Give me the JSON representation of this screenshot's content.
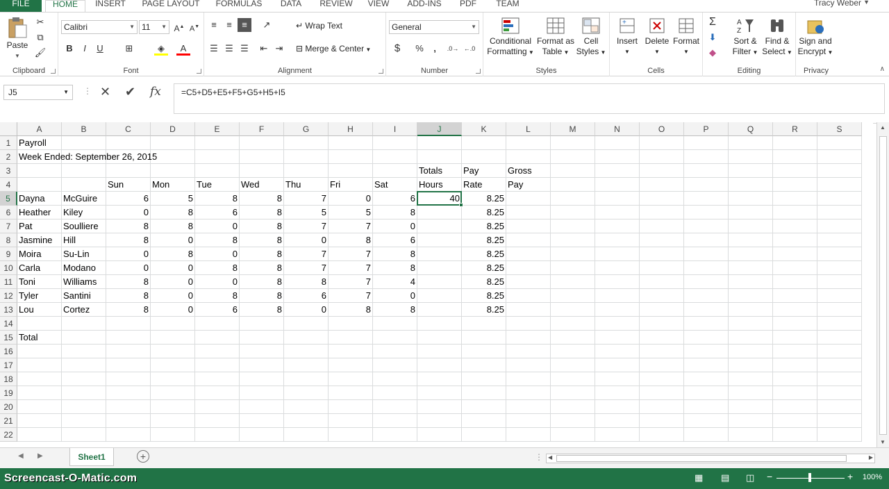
{
  "ribbon_tabs": [
    "FILE",
    "HOME",
    "INSERT",
    "PAGE LAYOUT",
    "FORMULAS",
    "DATA",
    "REVIEW",
    "VIEW",
    "ADD-INS",
    "PDF",
    "TEAM"
  ],
  "active_tab": "HOME",
  "user": "Tracy Weber",
  "clipboard": {
    "label": "Clipboard",
    "paste": "Paste"
  },
  "font": {
    "label": "Font",
    "name": "Calibri",
    "size": "11",
    "bold": "B",
    "italic": "I",
    "underline": "U"
  },
  "alignment": {
    "label": "Alignment",
    "wrap": "Wrap Text",
    "merge": "Merge & Center"
  },
  "number": {
    "label": "Number",
    "format": "General",
    "currency": "$",
    "percent": "%",
    "comma": ","
  },
  "styles": {
    "label": "Styles",
    "cond1": "Conditional",
    "cond2": "Formatting",
    "fmt1": "Format as",
    "fmt2": "Table",
    "cell1": "Cell",
    "cell2": "Styles"
  },
  "cells": {
    "label": "Cells",
    "insert": "Insert",
    "delete": "Delete",
    "format": "Format"
  },
  "editing": {
    "label": "Editing",
    "sort1": "Sort &",
    "sort2": "Filter",
    "find1": "Find &",
    "find2": "Select"
  },
  "privacy": {
    "label": "Privacy",
    "sign1": "Sign and",
    "sign2": "Encrypt"
  },
  "name_box": "J5",
  "formula": "=C5+D5+E5+F5+G5+H5+I5",
  "columns": [
    "A",
    "B",
    "C",
    "D",
    "E",
    "F",
    "G",
    "H",
    "I",
    "J",
    "K",
    "L",
    "M",
    "N",
    "O",
    "P",
    "Q",
    "R",
    "S"
  ],
  "rows": [
    "1",
    "2",
    "3",
    "4",
    "5",
    "6",
    "7",
    "8",
    "9",
    "10",
    "11",
    "12",
    "13",
    "14",
    "15",
    "16",
    "17",
    "18",
    "19",
    "20",
    "21",
    "22"
  ],
  "cells_data": {
    "A1": "Payroll",
    "A2": "Week Ended: September 26, 2015",
    "J3": "Totals",
    "K3": "Pay",
    "L3": "Gross",
    "C4": "Sun",
    "D4": "Mon",
    "E4": "Tue",
    "F4": "Wed",
    "G4": "Thu",
    "H4": "Fri",
    "I4": "Sat",
    "J4": "Hours",
    "K4": "Rate",
    "L4": "Pay",
    "A5": "Dayna",
    "B5": "McGuire",
    "C5": "6",
    "D5": "5",
    "E5": "8",
    "F5": "8",
    "G5": "7",
    "H5": "0",
    "I5": "6",
    "J5": "40",
    "K5": "8.25",
    "A6": "Heather",
    "B6": "Kiley",
    "C6": "0",
    "D6": "8",
    "E6": "6",
    "F6": "8",
    "G6": "5",
    "H6": "5",
    "I6": "8",
    "K6": "8.25",
    "A7": "Pat",
    "B7": "Soulliere",
    "C7": "8",
    "D7": "8",
    "E7": "0",
    "F7": "8",
    "G7": "7",
    "H7": "7",
    "I7": "0",
    "K7": "8.25",
    "A8": "Jasmine",
    "B8": "Hill",
    "C8": "8",
    "D8": "0",
    "E8": "8",
    "F8": "8",
    "G8": "0",
    "H8": "8",
    "I8": "6",
    "K8": "8.25",
    "A9": "Moira",
    "B9": "Su-Lin",
    "C9": "0",
    "D9": "8",
    "E9": "0",
    "F9": "8",
    "G9": "7",
    "H9": "7",
    "I9": "8",
    "K9": "8.25",
    "A10": "Carla",
    "B10": "Modano",
    "C10": "0",
    "D10": "0",
    "E10": "8",
    "F10": "8",
    "G10": "7",
    "H10": "7",
    "I10": "8",
    "K10": "8.25",
    "A11": "Toni",
    "B11": "Williams",
    "C11": "8",
    "D11": "0",
    "E11": "0",
    "F11": "8",
    "G11": "8",
    "H11": "7",
    "I11": "4",
    "K11": "8.25",
    "A12": "Tyler",
    "B12": "Santini",
    "C12": "8",
    "D12": "0",
    "E12": "8",
    "F12": "8",
    "G12": "6",
    "H12": "7",
    "I12": "0",
    "K12": "8.25",
    "A13": "Lou",
    "B13": "Cortez",
    "C13": "8",
    "D13": "0",
    "E13": "6",
    "F13": "8",
    "G13": "0",
    "H13": "8",
    "I13": "8",
    "K13": "8.25",
    "A15": "Total"
  },
  "active_cell": "J5",
  "sheet_tab": "Sheet1",
  "watermark": "Screencast-O-Matic.com",
  "zoom": "100%",
  "colors": {
    "accent": "#217346",
    "grid": "#dadcdd"
  }
}
